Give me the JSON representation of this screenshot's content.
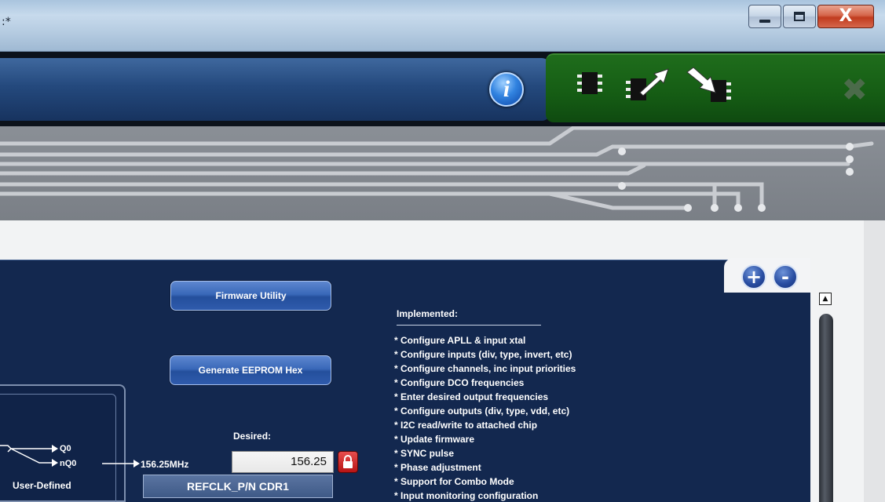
{
  "window": {
    "title_fragment": ":*",
    "controls": {
      "minimize": "minimize",
      "maximize": "maximize",
      "close": "X"
    }
  },
  "header": {
    "info_icon": "i",
    "tools": [
      "chip-icon",
      "chip-export-icon",
      "chip-import-icon",
      "close-x-icon"
    ]
  },
  "buttons": {
    "firmware_utility": "Firmware Utility",
    "generate_eeprom_hex": "Generate EEPROM Hex",
    "zoom_in": "+",
    "zoom_out": "-"
  },
  "implemented": {
    "title": "Implemented:",
    "items": [
      "* Configure APLL & input xtal",
      "* Configure inputs (div, type, invert, etc)",
      "* Configure channels, inc input priorities",
      "* Configure DCO frequencies",
      "* Enter desired output frequencies",
      "* Configure outputs (div, type, vdd, etc)",
      "* I2C read/write to attached chip",
      "* Update firmware",
      "* SYNC pulse",
      "* Phase adjustment",
      "* Support for Combo Mode",
      "* Input monitoring configuration"
    ]
  },
  "device": {
    "output_q0": "Q0",
    "output_nq0": "nQ0",
    "profile": "User-Defined",
    "frequency_out": "156.25MHz"
  },
  "desired": {
    "label": "Desired:",
    "value": "156.25",
    "lock_icon": "lock-icon",
    "output_name": "REFCLK_P/N CDR1"
  },
  "scrollbar": {
    "up_arrow": "▲"
  }
}
